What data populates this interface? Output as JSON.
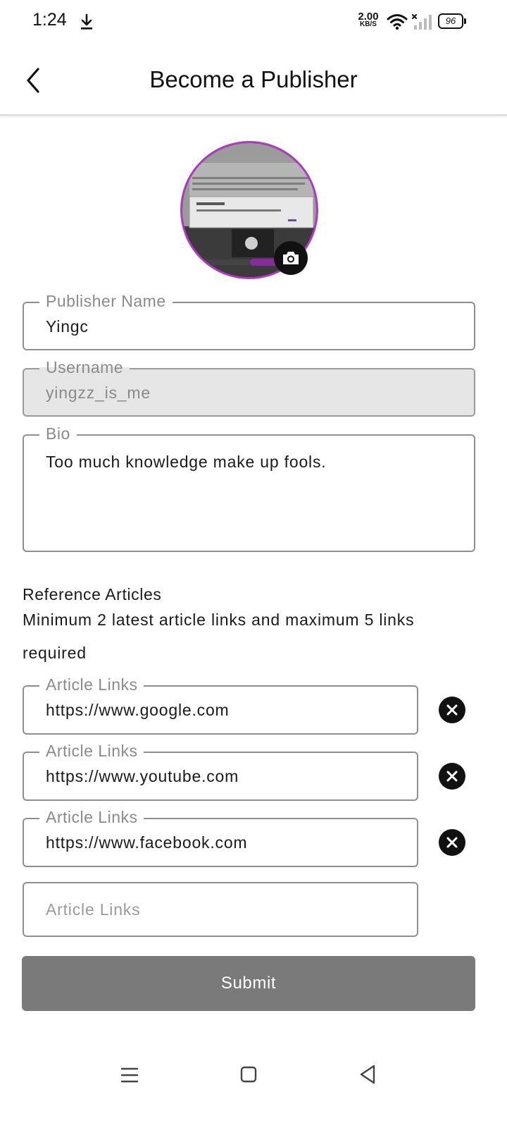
{
  "status_bar": {
    "time": "1:24",
    "net_speed_value": "2.00",
    "net_speed_unit": "KB/S",
    "battery": "96",
    "icons": [
      "download-icon",
      "wifi-icon",
      "signal-icon",
      "battery-icon"
    ]
  },
  "app_bar": {
    "title": "Become a Publisher",
    "back_icon": "chevron-left-icon"
  },
  "avatar": {
    "border_color": "#b038c4",
    "camera_icon": "camera-icon"
  },
  "form": {
    "publisher_name": {
      "label": "Publisher Name",
      "value": "Yingc"
    },
    "username": {
      "label": "Username",
      "value": "yingzz_is_me"
    },
    "bio": {
      "label": "Bio",
      "value": "Too much knowledge make up fools."
    }
  },
  "reference": {
    "title": "Reference Articles",
    "description": "Minimum 2 latest article links and maximum 5 links required",
    "links": [
      {
        "label": "Article Links",
        "value": "https://www.google.com"
      },
      {
        "label": "Article Links",
        "value": "https://www.youtube.com"
      },
      {
        "label": "Article Links",
        "value": "https://www.facebook.com"
      }
    ],
    "new_link_placeholder": "Article Links"
  },
  "submit": {
    "label": "Submit",
    "color": "#7a7a7a"
  },
  "nav_bar": {
    "icons": [
      "menu-icon",
      "home-icon",
      "back-icon"
    ]
  }
}
